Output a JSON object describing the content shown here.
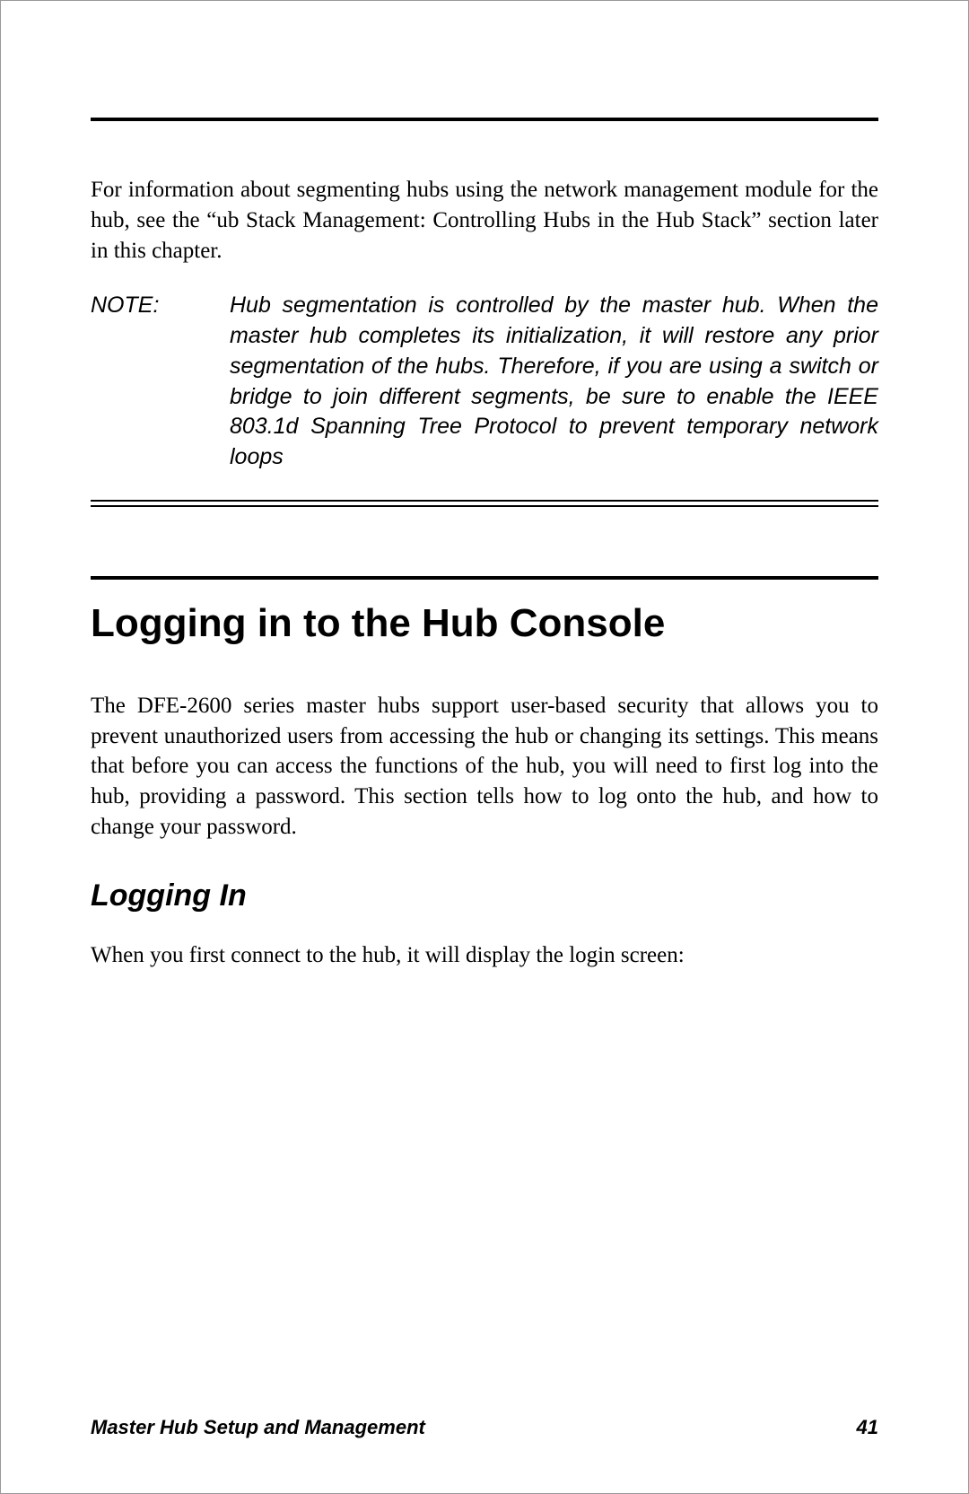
{
  "intro_paragraph": "For information about segmenting hubs using the network management module for the hub, see the “ub Stack Management: Controlling Hubs in the Hub Stack” section later in this chapter.",
  "note": {
    "label": "NOTE:",
    "body": "Hub segmentation is controlled by the master hub. When the master hub completes its initialization, it will restore any prior segmentation of the hubs. Therefore, if you are using a switch or bridge to join different segments, be sure to enable the IEEE 803.1d Spanning Tree Protocol to prevent temporary network loops"
  },
  "section_heading": "Logging in to the Hub Console",
  "section_body": "The DFE-2600 series master hubs support user-based security that allows you to prevent unauthorized users from accessing the hub or changing its settings. This means that before you can access the functions of the hub, you will need to first log into the hub, providing a password. This section tells how to log onto the hub, and how to change your password.",
  "sub_heading": "Logging In",
  "sub_body": "When you first connect to the hub, it will display the login screen:",
  "footer": {
    "title": "Master Hub Setup and Management",
    "page": "41"
  }
}
